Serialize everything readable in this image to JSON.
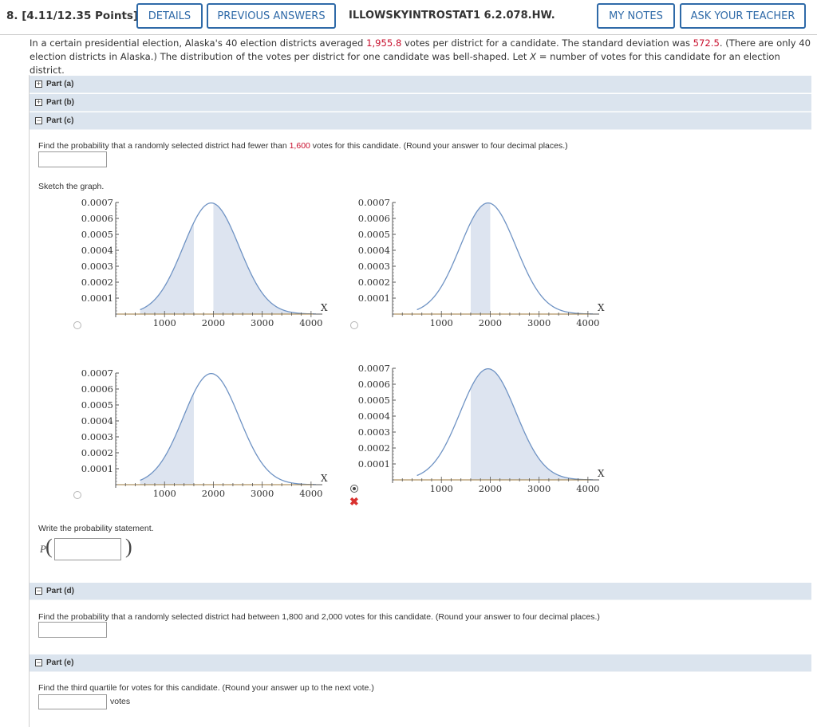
{
  "header": {
    "question_number": "8. [4.11/12.35 Points]",
    "details": "DETAILS",
    "previous_answers": "PREVIOUS ANSWERS",
    "assignment": "ILLOWSKYINTROSTAT1 6.2.078.HW.",
    "my_notes": "MY NOTES",
    "ask_teacher": "ASK YOUR TEACHER"
  },
  "question": {
    "p1": "In a certain presidential election, Alaska's 40 election districts averaged ",
    "mean": "1,955.8",
    "p2": " votes per district for a candidate. The standard deviation was ",
    "sd": "572.5",
    "p3": ". (There are only 40 election districts in Alaska.) The distribution of the votes per district for one candidate was bell-shaped. Let ",
    "var": "X",
    "p4": " = number of votes for this candidate for an election district."
  },
  "parts": {
    "a": {
      "label": "Part (a)",
      "toggle": "+"
    },
    "b": {
      "label": "Part (b)",
      "toggle": "+"
    },
    "c": {
      "label": "Part (c)",
      "toggle": "−",
      "prompt1": "Find the probability that a randomly selected district had fewer than ",
      "value": "1,600",
      "prompt2": " votes for this candidate. (Round your answer to four decimal places.)",
      "sketch_label": "Sketch the graph.",
      "prob_label": "Write the probability statement.",
      "prob_symbol": "P",
      "open_paren": "(",
      "close_paren": ")"
    },
    "d": {
      "label": "Part (d)",
      "toggle": "−",
      "prompt": "Find the probability that a randomly selected district had between 1,800 and 2,000 votes for this candidate. (Round your answer to four decimal places.)"
    },
    "e": {
      "label": "Part (e)",
      "toggle": "−",
      "prompt": "Find the third quartile for votes for this candidate. (Round your answer up to the next vote.)",
      "unit": "votes"
    }
  },
  "feedback": {
    "wrong_mark": "✖"
  },
  "colors": {
    "accent": "#2f6aa8",
    "red": "#c8102e",
    "curve": "#6f93c4",
    "shade": "#dde4f0",
    "axis": "#9c7a3c"
  },
  "chart_data": [
    {
      "type": "area",
      "option": 1,
      "selected": false,
      "mean": 1955.8,
      "sd": 572.5,
      "shaded_intervals": [
        [
          0,
          1600
        ],
        [
          2000,
          4100
        ]
      ],
      "yticks": [
        "0.0001",
        "0.0002",
        "0.0003",
        "0.0004",
        "0.0005",
        "0.0006",
        "0.0007"
      ],
      "xticks": [
        "1000",
        "2000",
        "3000",
        "4000"
      ],
      "xlabel": "X",
      "xlim": [
        0,
        4100
      ],
      "ylim": [
        0,
        0.0007
      ]
    },
    {
      "type": "area",
      "option": 2,
      "selected": false,
      "mean": 1955.8,
      "sd": 572.5,
      "shaded_intervals": [
        [
          1600,
          2000
        ]
      ],
      "yticks": [
        "0.0001",
        "0.0002",
        "0.0003",
        "0.0004",
        "0.0005",
        "0.0006",
        "0.0007"
      ],
      "xticks": [
        "1000",
        "2000",
        "3000",
        "4000"
      ],
      "xlabel": "X",
      "xlim": [
        0,
        4100
      ],
      "ylim": [
        0,
        0.0007
      ]
    },
    {
      "type": "area",
      "option": 3,
      "selected": false,
      "mean": 1955.8,
      "sd": 572.5,
      "shaded_intervals": [
        [
          0,
          1600
        ]
      ],
      "yticks": [
        "0.0001",
        "0.0002",
        "0.0003",
        "0.0004",
        "0.0005",
        "0.0006",
        "0.0007"
      ],
      "xticks": [
        "1000",
        "2000",
        "3000",
        "4000"
      ],
      "xlabel": "X",
      "xlim": [
        0,
        4100
      ],
      "ylim": [
        0,
        0.0007
      ]
    },
    {
      "type": "area",
      "option": 4,
      "selected": true,
      "marked_wrong": true,
      "mean": 1955.8,
      "sd": 572.5,
      "shaded_intervals": [
        [
          1600,
          4100
        ]
      ],
      "yticks": [
        "0.0001",
        "0.0002",
        "0.0003",
        "0.0004",
        "0.0005",
        "0.0006",
        "0.0007"
      ],
      "xticks": [
        "1000",
        "2000",
        "3000",
        "4000"
      ],
      "xlabel": "X",
      "xlim": [
        0,
        4100
      ],
      "ylim": [
        0,
        0.0007
      ]
    }
  ]
}
